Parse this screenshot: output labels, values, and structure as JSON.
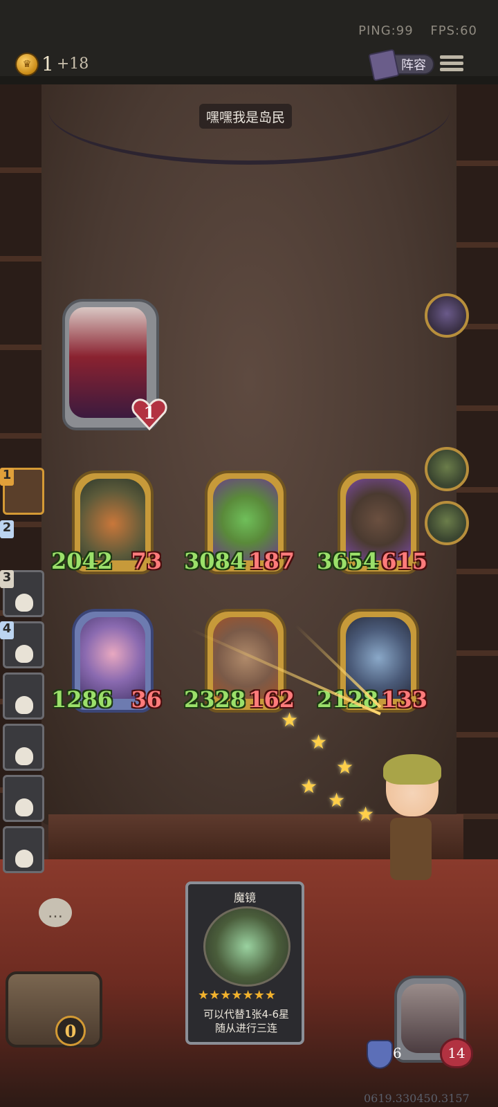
{
  "top": {
    "ping_label": "PING:99",
    "fps_label": "FPS:60",
    "coins": "1",
    "coin_increment": "+18",
    "lineup_label": "阵容"
  },
  "banner": {
    "text": "嘿嘿我是岛民"
  },
  "boss": {
    "health": "1"
  },
  "board": {
    "row1": [
      {
        "name": "pumpkin-monster",
        "atk": "2042",
        "hp": "73"
      },
      {
        "name": "cactus-monster",
        "atk": "3084",
        "hp": "187"
      },
      {
        "name": "tiki-monster",
        "atk": "3654",
        "hp": "615"
      }
    ],
    "row2": [
      {
        "name": "pink-hair-knight",
        "atk": "1286",
        "hp": "36"
      },
      {
        "name": "tree-golem",
        "atk": "2328",
        "hp": "162"
      },
      {
        "name": "bat-demon",
        "atk": "2128",
        "hp": "133"
      }
    ]
  },
  "queue": [
    "1",
    "2",
    "3",
    "4"
  ],
  "treasure": {
    "count": "0"
  },
  "selected_card": {
    "title": "魔镜",
    "stars": "★★★★★★★",
    "description_line1": "可以代替1张4-6星",
    "description_line2": "随从进行三连"
  },
  "player": {
    "armor": "6",
    "health": "14"
  },
  "seed": "0619.330450.3157",
  "colors": {
    "gold": "#c79a3a",
    "atk_green": "#9be06a",
    "hp_red": "#ff7b7b",
    "floor_red": "#8a3a2c"
  },
  "icons": {
    "coin": "crown-coin-icon",
    "lineup": "book-icon",
    "menu": "hamburger-menu-icon",
    "chat": "chat-bubble-icon",
    "armor": "shield-icon",
    "health": "heart-icon"
  }
}
